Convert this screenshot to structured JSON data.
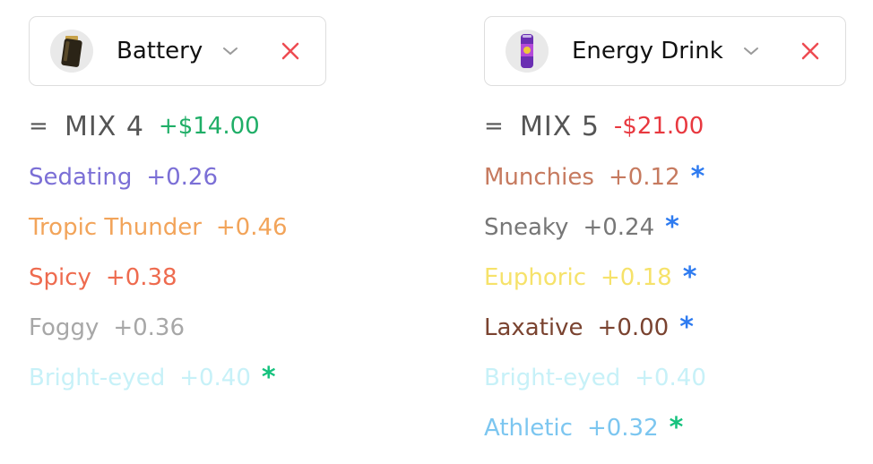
{
  "left": {
    "title": "Battery",
    "mix_prefix": "=",
    "mix_label": "MIX 4",
    "price": "+$14.00",
    "price_color": "#1fae67",
    "effects": [
      {
        "name": "Sedating",
        "value": "+0.26",
        "color": "#7b6fd6",
        "star": "",
        "star_color": ""
      },
      {
        "name": "Tropic Thunder",
        "value": "+0.46",
        "color": "#f2a45a",
        "star": "",
        "star_color": ""
      },
      {
        "name": "Spicy",
        "value": "+0.38",
        "color": "#ee6b4f",
        "star": "",
        "star_color": ""
      },
      {
        "name": "Foggy",
        "value": "+0.36",
        "color": "#a7a7a7",
        "star": "",
        "star_color": ""
      },
      {
        "name": "Bright-eyed",
        "value": "+0.40",
        "color": "#c7f1f8",
        "star": "*",
        "star_color": "#16c27e"
      }
    ]
  },
  "right": {
    "title": "Energy Drink",
    "mix_prefix": "=",
    "mix_label": "MIX 5",
    "price": "-$21.00",
    "price_color": "#e8383f",
    "effects": [
      {
        "name": "Munchies",
        "value": "+0.12",
        "color": "#c67a5f",
        "star": "*",
        "star_color": "#2e7bf0"
      },
      {
        "name": "Sneaky",
        "value": "+0.24",
        "color": "#777777",
        "star": "*",
        "star_color": "#2e7bf0"
      },
      {
        "name": "Euphoric",
        "value": "+0.18",
        "color": "#f6e26a",
        "star": "*",
        "star_color": "#2e7bf0"
      },
      {
        "name": "Laxative",
        "value": "+0.00",
        "color": "#7a4330",
        "star": "*",
        "star_color": "#2e7bf0"
      },
      {
        "name": "Bright-eyed",
        "value": "+0.40",
        "color": "#c7f1f8",
        "star": "",
        "star_color": ""
      },
      {
        "name": "Athletic",
        "value": "+0.32",
        "color": "#7cc6f0",
        "star": "*",
        "star_color": "#16c27e"
      }
    ]
  },
  "icons": {
    "left_avatar": "battery-icon",
    "right_avatar": "energy-drink-icon",
    "chevron": "chevron-down-icon",
    "close": "close-icon"
  }
}
